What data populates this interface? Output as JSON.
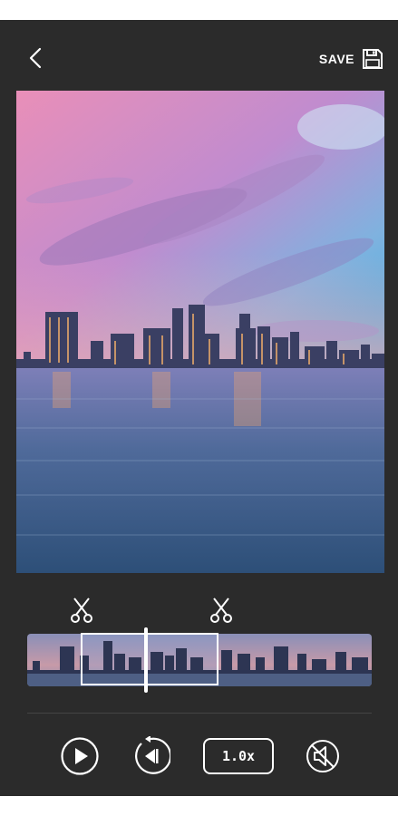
{
  "header": {
    "back_icon": "chevron-left-icon",
    "save_label": "SAVE",
    "save_icon": "floppy-disk-icon"
  },
  "trim": {
    "left_icon": "scissors-icon",
    "right_icon": "scissors-icon"
  },
  "controls": {
    "play_icon": "play-icon",
    "rewind_icon": "rewind-icon",
    "speed_label": "1.0x",
    "mute_icon": "mute-icon"
  },
  "colors": {
    "background": "#2b2b2b",
    "accent": "#ffffff"
  }
}
